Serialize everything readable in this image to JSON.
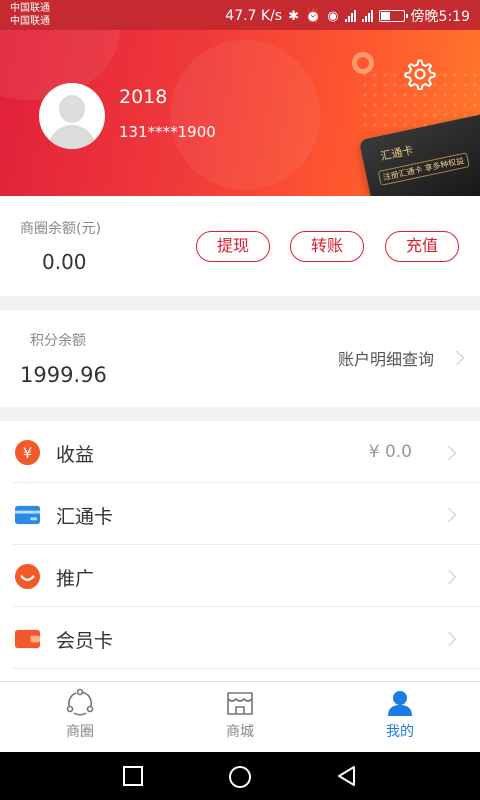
{
  "status_bar": {
    "carrier1": "中国联通",
    "carrier2": "中国联通",
    "speed": "47.7 K/s",
    "time": "傍晚5:19"
  },
  "profile": {
    "username": "2018",
    "phone": "131****1900",
    "card_title": "汇通卡",
    "card_subtitle": "注册汇通卡 享多种权益"
  },
  "balance": {
    "label": "商圈余额(元)",
    "value": "0.00",
    "withdraw_label": "提现",
    "transfer_label": "转账",
    "recharge_label": "充值"
  },
  "points": {
    "label": "积分余额",
    "value": "1999.96",
    "details_link": "账户明细查询"
  },
  "menu": {
    "items": [
      {
        "label": "收益",
        "value": "¥  0.0",
        "icon": "yen-coin-icon"
      },
      {
        "label": "汇通卡",
        "value": "",
        "icon": "card-icon"
      },
      {
        "label": "推广",
        "value": "",
        "icon": "smile-icon"
      },
      {
        "label": "会员卡",
        "value": "",
        "icon": "wallet-icon"
      }
    ]
  },
  "tabbar": {
    "tabs": [
      {
        "label": "商圈",
        "icon": "circle-network-icon"
      },
      {
        "label": "商城",
        "icon": "store-icon"
      },
      {
        "label": "我的",
        "icon": "person-icon"
      }
    ],
    "active": "我的"
  },
  "colors": {
    "accent_red": "#e0202f",
    "active_blue": "#1a7de0"
  }
}
